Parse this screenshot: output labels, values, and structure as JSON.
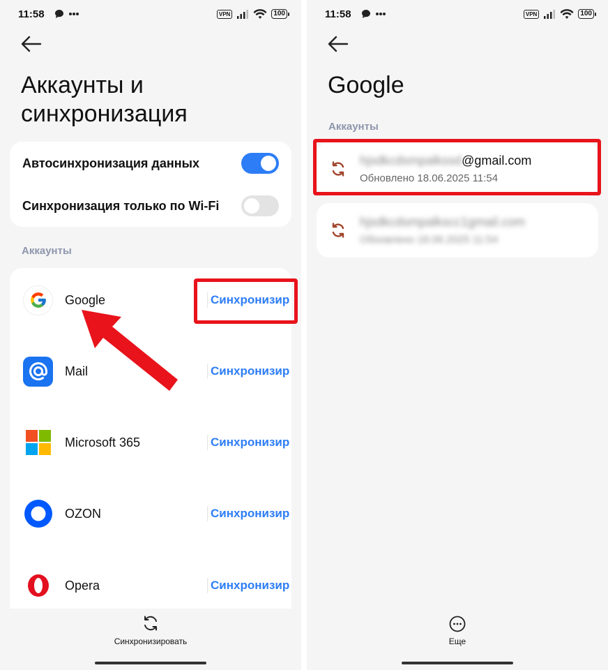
{
  "left_screen": {
    "status": {
      "time": "11:58",
      "vpn": "VPN",
      "battery": "100"
    },
    "title": "Аккаунты и\nсинхронизация",
    "settings": [
      {
        "label": "Автосинхронизация данных",
        "enabled": true
      },
      {
        "label": "Синхронизация только по Wi-Fi",
        "enabled": false
      }
    ],
    "accounts_section_label": "Аккаунты",
    "accounts": [
      {
        "name": "Google",
        "action": "Синхронизировать",
        "icon": "google-icon"
      },
      {
        "name": "Mail",
        "action": "Синхронизировать",
        "icon": "mail-at-icon"
      },
      {
        "name": "Microsoft 365",
        "action": "Синхронизировать",
        "icon": "microsoft-icon"
      },
      {
        "name": "OZON",
        "action": "Синхронизировать",
        "icon": "ozon-icon"
      },
      {
        "name": "Opera",
        "action": "Синхронизировать",
        "icon": "opera-icon"
      }
    ],
    "bottom_action": {
      "label": "Синхронизировать",
      "icon": "sync-icon"
    }
  },
  "right_screen": {
    "status": {
      "time": "11:58",
      "vpn": "VPN",
      "battery": "100"
    },
    "title": "Google",
    "accounts_section_label": "Аккаунты",
    "google_accounts": [
      {
        "email_hidden": "hjsdkcdsmpalkssd",
        "email_domain": "@gmail.com",
        "updated": "Обновлено 18.06.2025 11:54"
      },
      {
        "email_hidden": "hjsdkcdsmpalkscc1gmail.com",
        "updated": "Обновлено 18.06.2025 11:54"
      }
    ],
    "bottom_action": {
      "label": "Еще",
      "icon": "more-icon"
    }
  },
  "colors": {
    "accent": "#2d7df6",
    "highlight": "#e8131b",
    "section": "#8e96ad",
    "sync_glyph": "#a0432a"
  }
}
